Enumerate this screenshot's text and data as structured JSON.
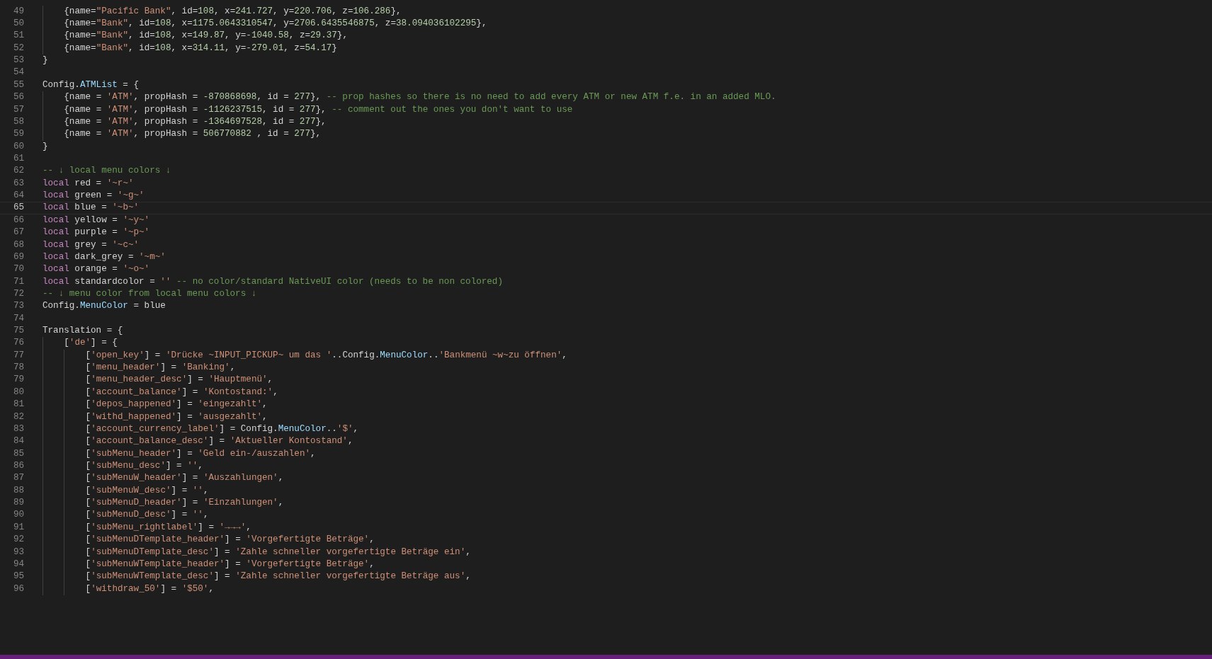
{
  "lines": [
    {
      "children": [
        {
          "number": "49",
          "current": false,
          "tokens": [
            {
              "kind": "plain",
              "text": "{name="
            },
            {
              "kind": "string",
              "text": "\"Pacific Bank\""
            },
            {
              "kind": "plain",
              "text": ", id="
            },
            {
              "kind": "number",
              "text": "108"
            },
            {
              "kind": "plain",
              "text": ", x="
            },
            {
              "kind": "number",
              "text": "241.727"
            },
            {
              "kind": "plain",
              "text": ", y="
            },
            {
              "kind": "number",
              "text": "220.706"
            },
            {
              "kind": "plain",
              "text": ", z="
            },
            {
              "kind": "number",
              "text": "106.286"
            },
            {
              "kind": "plain",
              "text": "},"
            }
          ]
        },
        {
          "number": "50",
          "current": false,
          "tokens": [
            {
              "kind": "plain",
              "text": "{name="
            },
            {
              "kind": "string",
              "text": "\"Bank\""
            },
            {
              "kind": "plain",
              "text": ", id="
            },
            {
              "kind": "number",
              "text": "108"
            },
            {
              "kind": "plain",
              "text": ", x="
            },
            {
              "kind": "number",
              "text": "1175.0643310547"
            },
            {
              "kind": "plain",
              "text": ", y="
            },
            {
              "kind": "number",
              "text": "2706.6435546875"
            },
            {
              "kind": "plain",
              "text": ", z="
            },
            {
              "kind": "number",
              "text": "38.094036102295"
            },
            {
              "kind": "plain",
              "text": "},"
            }
          ]
        },
        {
          "number": "51",
          "current": false,
          "tokens": [
            {
              "kind": "plain",
              "text": "{name="
            },
            {
              "kind": "string",
              "text": "\"Bank\""
            },
            {
              "kind": "plain",
              "text": ", id="
            },
            {
              "kind": "number",
              "text": "108"
            },
            {
              "kind": "plain",
              "text": ", x="
            },
            {
              "kind": "number",
              "text": "149.87"
            },
            {
              "kind": "plain",
              "text": ", y="
            },
            {
              "kind": "number",
              "text": "-1040.58"
            },
            {
              "kind": "plain",
              "text": ", z="
            },
            {
              "kind": "number",
              "text": "29.37"
            },
            {
              "kind": "plain",
              "text": "},"
            }
          ]
        },
        {
          "number": "52",
          "current": false,
          "tokens": [
            {
              "kind": "plain",
              "text": "{name="
            },
            {
              "kind": "string",
              "text": "\"Bank\""
            },
            {
              "kind": "plain",
              "text": ", id="
            },
            {
              "kind": "number",
              "text": "108"
            },
            {
              "kind": "plain",
              "text": ", x="
            },
            {
              "kind": "number",
              "text": "314.11"
            },
            {
              "kind": "plain",
              "text": ", y="
            },
            {
              "kind": "number",
              "text": "-279.01"
            },
            {
              "kind": "plain",
              "text": ", z="
            },
            {
              "kind": "number",
              "text": "54.17"
            },
            {
              "kind": "plain",
              "text": "}"
            }
          ]
        }
      ]
    },
    {
      "number": "53",
      "current": false,
      "tokens": [
        {
          "kind": "plain",
          "text": "}"
        }
      ]
    },
    {
      "number": "54",
      "current": false
    },
    {
      "number": "55",
      "current": false,
      "tokens": [
        {
          "kind": "plain",
          "text": "Config."
        },
        {
          "kind": "property",
          "text": "ATMList"
        },
        {
          "kind": "plain",
          "text": " = {"
        }
      ],
      "children": [
        {
          "number": "56",
          "current": false,
          "tokens": [
            {
              "kind": "plain",
              "text": "{name = "
            },
            {
              "kind": "string",
              "text": "'ATM'"
            },
            {
              "kind": "plain",
              "text": ", propHash = "
            },
            {
              "kind": "number",
              "text": "-870868698"
            },
            {
              "kind": "plain",
              "text": ", id = "
            },
            {
              "kind": "number",
              "text": "277"
            },
            {
              "kind": "plain",
              "text": "}, "
            },
            {
              "kind": "comment",
              "text": "-- prop hashes so there is no need to add every ATM or new ATM f.e. in an added MLO."
            }
          ]
        },
        {
          "number": "57",
          "current": false,
          "tokens": [
            {
              "kind": "plain",
              "text": "{name = "
            },
            {
              "kind": "string",
              "text": "'ATM'"
            },
            {
              "kind": "plain",
              "text": ", propHash = "
            },
            {
              "kind": "number",
              "text": "-1126237515"
            },
            {
              "kind": "plain",
              "text": ", id = "
            },
            {
              "kind": "number",
              "text": "277"
            },
            {
              "kind": "plain",
              "text": "}, "
            },
            {
              "kind": "comment",
              "text": "-- comment out the ones you don't want to use"
            }
          ]
        },
        {
          "number": "58",
          "current": false,
          "tokens": [
            {
              "kind": "plain",
              "text": "{name = "
            },
            {
              "kind": "string",
              "text": "'ATM'"
            },
            {
              "kind": "plain",
              "text": ", propHash = "
            },
            {
              "kind": "number",
              "text": "-1364697528"
            },
            {
              "kind": "plain",
              "text": ", id = "
            },
            {
              "kind": "number",
              "text": "277"
            },
            {
              "kind": "plain",
              "text": "},"
            }
          ]
        },
        {
          "number": "59",
          "current": false,
          "tokens": [
            {
              "kind": "plain",
              "text": "{name = "
            },
            {
              "kind": "string",
              "text": "'ATM'"
            },
            {
              "kind": "plain",
              "text": ", propHash = "
            },
            {
              "kind": "number",
              "text": "506770882"
            },
            {
              "kind": "plain",
              "text": " , id = "
            },
            {
              "kind": "number",
              "text": "277"
            },
            {
              "kind": "plain",
              "text": "},"
            }
          ]
        }
      ]
    },
    {
      "number": "60",
      "current": false,
      "tokens": [
        {
          "kind": "plain",
          "text": "}"
        }
      ]
    },
    {
      "number": "61",
      "current": false
    },
    {
      "number": "62",
      "current": false,
      "tokens": [
        {
          "kind": "comment",
          "text": "-- ↓ local menu colors ↓"
        }
      ]
    },
    {
      "number": "63",
      "current": false,
      "tokens": [
        {
          "kind": "keyword",
          "text": "local"
        },
        {
          "kind": "plain",
          "text": " red = "
        },
        {
          "kind": "string",
          "text": "'~r~'"
        }
      ]
    },
    {
      "number": "64",
      "current": false,
      "tokens": [
        {
          "kind": "keyword",
          "text": "local"
        },
        {
          "kind": "plain",
          "text": " green = "
        },
        {
          "kind": "string",
          "text": "'~g~'"
        }
      ]
    },
    {
      "number": "65",
      "current": true,
      "tokens": [
        {
          "kind": "keyword",
          "text": "local"
        },
        {
          "kind": "plain",
          "text": " blue = "
        },
        {
          "kind": "string",
          "text": "'~b~'"
        }
      ]
    },
    {
      "number": "66",
      "current": false,
      "tokens": [
        {
          "kind": "keyword",
          "text": "local"
        },
        {
          "kind": "plain",
          "text": " yellow = "
        },
        {
          "kind": "string",
          "text": "'~y~'"
        }
      ]
    },
    {
      "number": "67",
      "current": false,
      "tokens": [
        {
          "kind": "keyword",
          "text": "local"
        },
        {
          "kind": "plain",
          "text": " purple = "
        },
        {
          "kind": "string",
          "text": "'~p~'"
        }
      ]
    },
    {
      "number": "68",
      "current": false,
      "tokens": [
        {
          "kind": "keyword",
          "text": "local"
        },
        {
          "kind": "plain",
          "text": " grey = "
        },
        {
          "kind": "string",
          "text": "'~c~'"
        }
      ]
    },
    {
      "number": "69",
      "current": false,
      "tokens": [
        {
          "kind": "keyword",
          "text": "local"
        },
        {
          "kind": "plain",
          "text": " dark_grey = "
        },
        {
          "kind": "string",
          "text": "'~m~'"
        }
      ]
    },
    {
      "number": "70",
      "current": false,
      "tokens": [
        {
          "kind": "keyword",
          "text": "local"
        },
        {
          "kind": "plain",
          "text": " orange = "
        },
        {
          "kind": "string",
          "text": "'~o~'"
        }
      ]
    },
    {
      "number": "71",
      "current": false,
      "tokens": [
        {
          "kind": "keyword",
          "text": "local"
        },
        {
          "kind": "plain",
          "text": " standardcolor = "
        },
        {
          "kind": "string",
          "text": "'' "
        },
        {
          "kind": "comment",
          "text": "-- no color/standard NativeUI color (needs to be non colored)"
        }
      ]
    },
    {
      "number": "72",
      "current": false,
      "tokens": [
        {
          "kind": "comment",
          "text": "-- ↓ menu color from local menu colors ↓"
        }
      ]
    },
    {
      "number": "73",
      "current": false,
      "tokens": [
        {
          "kind": "plain",
          "text": "Config."
        },
        {
          "kind": "property",
          "text": "MenuColor"
        },
        {
          "kind": "plain",
          "text": " = blue"
        }
      ]
    },
    {
      "number": "74",
      "current": false
    },
    {
      "number": "75",
      "current": false,
      "tokens": [
        {
          "kind": "plain",
          "text": "Translation = {"
        }
      ],
      "children": [
        {
          "number": "76",
          "current": false,
          "tokens": [
            {
              "kind": "plain",
              "text": "["
            },
            {
              "kind": "string",
              "text": "'de'"
            },
            {
              "kind": "plain",
              "text": "] = {"
            }
          ],
          "children": [
            {
              "number": "77",
              "current": false,
              "tokens": [
                {
                  "kind": "plain",
                  "text": "["
                },
                {
                  "kind": "string",
                  "text": "'open_key'"
                },
                {
                  "kind": "plain",
                  "text": "] = "
                },
                {
                  "kind": "string",
                  "text": "'Drücke ~INPUT_PICKUP~ um das '"
                },
                {
                  "kind": "plain",
                  "text": "..Config."
                },
                {
                  "kind": "property",
                  "text": "MenuColor"
                },
                {
                  "kind": "plain",
                  "text": ".."
                },
                {
                  "kind": "string",
                  "text": "'Bankmenü ~w~zu öffnen'"
                },
                {
                  "kind": "plain",
                  "text": ","
                }
              ]
            },
            {
              "number": "78",
              "current": false,
              "tokens": [
                {
                  "kind": "plain",
                  "text": "["
                },
                {
                  "kind": "string",
                  "text": "'menu_header'"
                },
                {
                  "kind": "plain",
                  "text": "] = "
                },
                {
                  "kind": "string",
                  "text": "'Banking'"
                },
                {
                  "kind": "plain",
                  "text": ","
                }
              ]
            },
            {
              "number": "79",
              "current": false,
              "tokens": [
                {
                  "kind": "plain",
                  "text": "["
                },
                {
                  "kind": "string",
                  "text": "'menu_header_desc'"
                },
                {
                  "kind": "plain",
                  "text": "] = "
                },
                {
                  "kind": "string",
                  "text": "'Hauptmenü'"
                },
                {
                  "kind": "plain",
                  "text": ","
                }
              ]
            },
            {
              "number": "80",
              "current": false,
              "tokens": [
                {
                  "kind": "plain",
                  "text": "["
                },
                {
                  "kind": "string",
                  "text": "'account_balance'"
                },
                {
                  "kind": "plain",
                  "text": "] = "
                },
                {
                  "kind": "string",
                  "text": "'Kontostand:'"
                },
                {
                  "kind": "plain",
                  "text": ","
                }
              ]
            },
            {
              "number": "81",
              "current": false,
              "tokens": [
                {
                  "kind": "plain",
                  "text": "["
                },
                {
                  "kind": "string",
                  "text": "'depos_happened'"
                },
                {
                  "kind": "plain",
                  "text": "] = "
                },
                {
                  "kind": "string",
                  "text": "'eingezahlt'"
                },
                {
                  "kind": "plain",
                  "text": ","
                }
              ]
            },
            {
              "number": "82",
              "current": false,
              "tokens": [
                {
                  "kind": "plain",
                  "text": "["
                },
                {
                  "kind": "string",
                  "text": "'withd_happened'"
                },
                {
                  "kind": "plain",
                  "text": "] = "
                },
                {
                  "kind": "string",
                  "text": "'ausgezahlt'"
                },
                {
                  "kind": "plain",
                  "text": ","
                }
              ]
            },
            {
              "number": "83",
              "current": false,
              "tokens": [
                {
                  "kind": "plain",
                  "text": "["
                },
                {
                  "kind": "string",
                  "text": "'account_currency_label'"
                },
                {
                  "kind": "plain",
                  "text": "] = Config."
                },
                {
                  "kind": "property",
                  "text": "MenuColor"
                },
                {
                  "kind": "plain",
                  "text": ".."
                },
                {
                  "kind": "string",
                  "text": "'$'"
                },
                {
                  "kind": "plain",
                  "text": ","
                }
              ]
            },
            {
              "number": "84",
              "current": false,
              "tokens": [
                {
                  "kind": "plain",
                  "text": "["
                },
                {
                  "kind": "string",
                  "text": "'account_balance_desc'"
                },
                {
                  "kind": "plain",
                  "text": "] = "
                },
                {
                  "kind": "string",
                  "text": "'Aktueller Kontostand'"
                },
                {
                  "kind": "plain",
                  "text": ","
                }
              ]
            },
            {
              "number": "85",
              "current": false,
              "tokens": [
                {
                  "kind": "plain",
                  "text": "["
                },
                {
                  "kind": "string",
                  "text": "'subMenu_header'"
                },
                {
                  "kind": "plain",
                  "text": "] = "
                },
                {
                  "kind": "string",
                  "text": "'Geld ein-/auszahlen'"
                },
                {
                  "kind": "plain",
                  "text": ","
                }
              ]
            },
            {
              "number": "86",
              "current": false,
              "tokens": [
                {
                  "kind": "plain",
                  "text": "["
                },
                {
                  "kind": "string",
                  "text": "'subMenu_desc'"
                },
                {
                  "kind": "plain",
                  "text": "] = "
                },
                {
                  "kind": "string",
                  "text": "''"
                },
                {
                  "kind": "plain",
                  "text": ","
                }
              ]
            },
            {
              "number": "87",
              "current": false,
              "tokens": [
                {
                  "kind": "plain",
                  "text": "["
                },
                {
                  "kind": "string",
                  "text": "'subMenuW_header'"
                },
                {
                  "kind": "plain",
                  "text": "] = "
                },
                {
                  "kind": "string",
                  "text": "'Auszahlungen'"
                },
                {
                  "kind": "plain",
                  "text": ","
                }
              ]
            },
            {
              "number": "88",
              "current": false,
              "tokens": [
                {
                  "kind": "plain",
                  "text": "["
                },
                {
                  "kind": "string",
                  "text": "'subMenuW_desc'"
                },
                {
                  "kind": "plain",
                  "text": "] = "
                },
                {
                  "kind": "string",
                  "text": "''"
                },
                {
                  "kind": "plain",
                  "text": ","
                }
              ]
            },
            {
              "number": "89",
              "current": false,
              "tokens": [
                {
                  "kind": "plain",
                  "text": "["
                },
                {
                  "kind": "string",
                  "text": "'subMenuD_header'"
                },
                {
                  "kind": "plain",
                  "text": "] = "
                },
                {
                  "kind": "string",
                  "text": "'Einzahlungen'"
                },
                {
                  "kind": "plain",
                  "text": ","
                }
              ]
            },
            {
              "number": "90",
              "current": false,
              "tokens": [
                {
                  "kind": "plain",
                  "text": "["
                },
                {
                  "kind": "string",
                  "text": "'subMenuD_desc'"
                },
                {
                  "kind": "plain",
                  "text": "] = "
                },
                {
                  "kind": "string",
                  "text": "''"
                },
                {
                  "kind": "plain",
                  "text": ","
                }
              ]
            },
            {
              "number": "91",
              "current": false,
              "tokens": [
                {
                  "kind": "plain",
                  "text": "["
                },
                {
                  "kind": "string",
                  "text": "'subMenu_rightlabel'"
                },
                {
                  "kind": "plain",
                  "text": "] = "
                },
                {
                  "kind": "string",
                  "text": "'→→→'"
                },
                {
                  "kind": "plain",
                  "text": ","
                }
              ]
            },
            {
              "number": "92",
              "current": false,
              "tokens": [
                {
                  "kind": "plain",
                  "text": "["
                },
                {
                  "kind": "string",
                  "text": "'subMenuDTemplate_header'"
                },
                {
                  "kind": "plain",
                  "text": "] = "
                },
                {
                  "kind": "string",
                  "text": "'Vorgefertigte Beträge'"
                },
                {
                  "kind": "plain",
                  "text": ","
                }
              ]
            },
            {
              "number": "93",
              "current": false,
              "tokens": [
                {
                  "kind": "plain",
                  "text": "["
                },
                {
                  "kind": "string",
                  "text": "'subMenuDTemplate_desc'"
                },
                {
                  "kind": "plain",
                  "text": "] = "
                },
                {
                  "kind": "string",
                  "text": "'Zahle schneller vorgefertigte Beträge ein'"
                },
                {
                  "kind": "plain",
                  "text": ","
                }
              ]
            },
            {
              "number": "94",
              "current": false,
              "tokens": [
                {
                  "kind": "plain",
                  "text": "["
                },
                {
                  "kind": "string",
                  "text": "'subMenuWTemplate_header'"
                },
                {
                  "kind": "plain",
                  "text": "] = "
                },
                {
                  "kind": "string",
                  "text": "'Vorgefertigte Beträge'"
                },
                {
                  "kind": "plain",
                  "text": ","
                }
              ]
            },
            {
              "number": "95",
              "current": false,
              "tokens": [
                {
                  "kind": "plain",
                  "text": "["
                },
                {
                  "kind": "string",
                  "text": "'subMenuWTemplate_desc'"
                },
                {
                  "kind": "plain",
                  "text": "] = "
                },
                {
                  "kind": "string",
                  "text": "'Zahle schneller vorgefertigte Beträge aus'"
                },
                {
                  "kind": "plain",
                  "text": ","
                }
              ]
            },
            {
              "number": "96",
              "current": false,
              "tokens": [
                {
                  "kind": "plain",
                  "text": "["
                },
                {
                  "kind": "string",
                  "text": "'withdraw_50'"
                },
                {
                  "kind": "plain",
                  "text": "] = "
                },
                {
                  "kind": "string",
                  "text": "'$50'"
                },
                {
                  "kind": "plain",
                  "text": ","
                }
              ]
            }
          ]
        }
      ]
    }
  ]
}
